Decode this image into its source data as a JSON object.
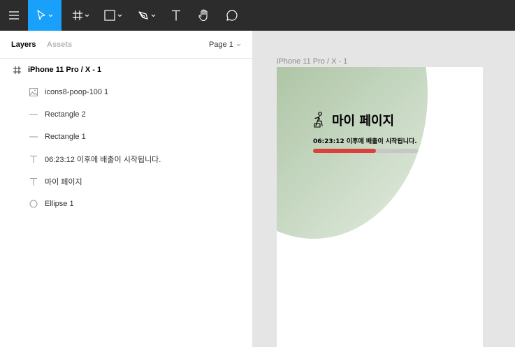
{
  "toolbar": {
    "tools": [
      {
        "name": "menu"
      },
      {
        "name": "move",
        "active": true
      },
      {
        "name": "frame"
      },
      {
        "name": "shape"
      },
      {
        "name": "pen"
      },
      {
        "name": "text"
      },
      {
        "name": "hand"
      },
      {
        "name": "comment"
      }
    ],
    "accent_color": "#18a0fb",
    "bg_color": "#2c2c2c"
  },
  "panel": {
    "tabs": [
      {
        "label": "Layers"
      },
      {
        "label": "Assets"
      }
    ],
    "page_selector": "Page 1",
    "layers": [
      {
        "label": "iPhone 11 Pro / X - 1",
        "icon": "frame-icon"
      },
      {
        "label": "icons8-poop-100 1",
        "icon": "image-icon"
      },
      {
        "label": "Rectangle 2",
        "icon": "line-icon"
      },
      {
        "label": "Rectangle 1",
        "icon": "line-icon"
      },
      {
        "label": "06:23:12 이후에 배출이 시작됩니다.",
        "icon": "text-icon"
      },
      {
        "label": "마이 페이지",
        "icon": "text-icon"
      },
      {
        "label": "Ellipse 1",
        "icon": "ellipse-icon"
      }
    ]
  },
  "canvas": {
    "frame_label": "iPhone 11 Pro / X - 1",
    "title": "마이 페이지",
    "subtitle": "06:23:12 이후에 배출이 시작됩니다.",
    "progress": 0.6,
    "progress_color": "#d9423a",
    "track_color": "#c7c7c7"
  }
}
